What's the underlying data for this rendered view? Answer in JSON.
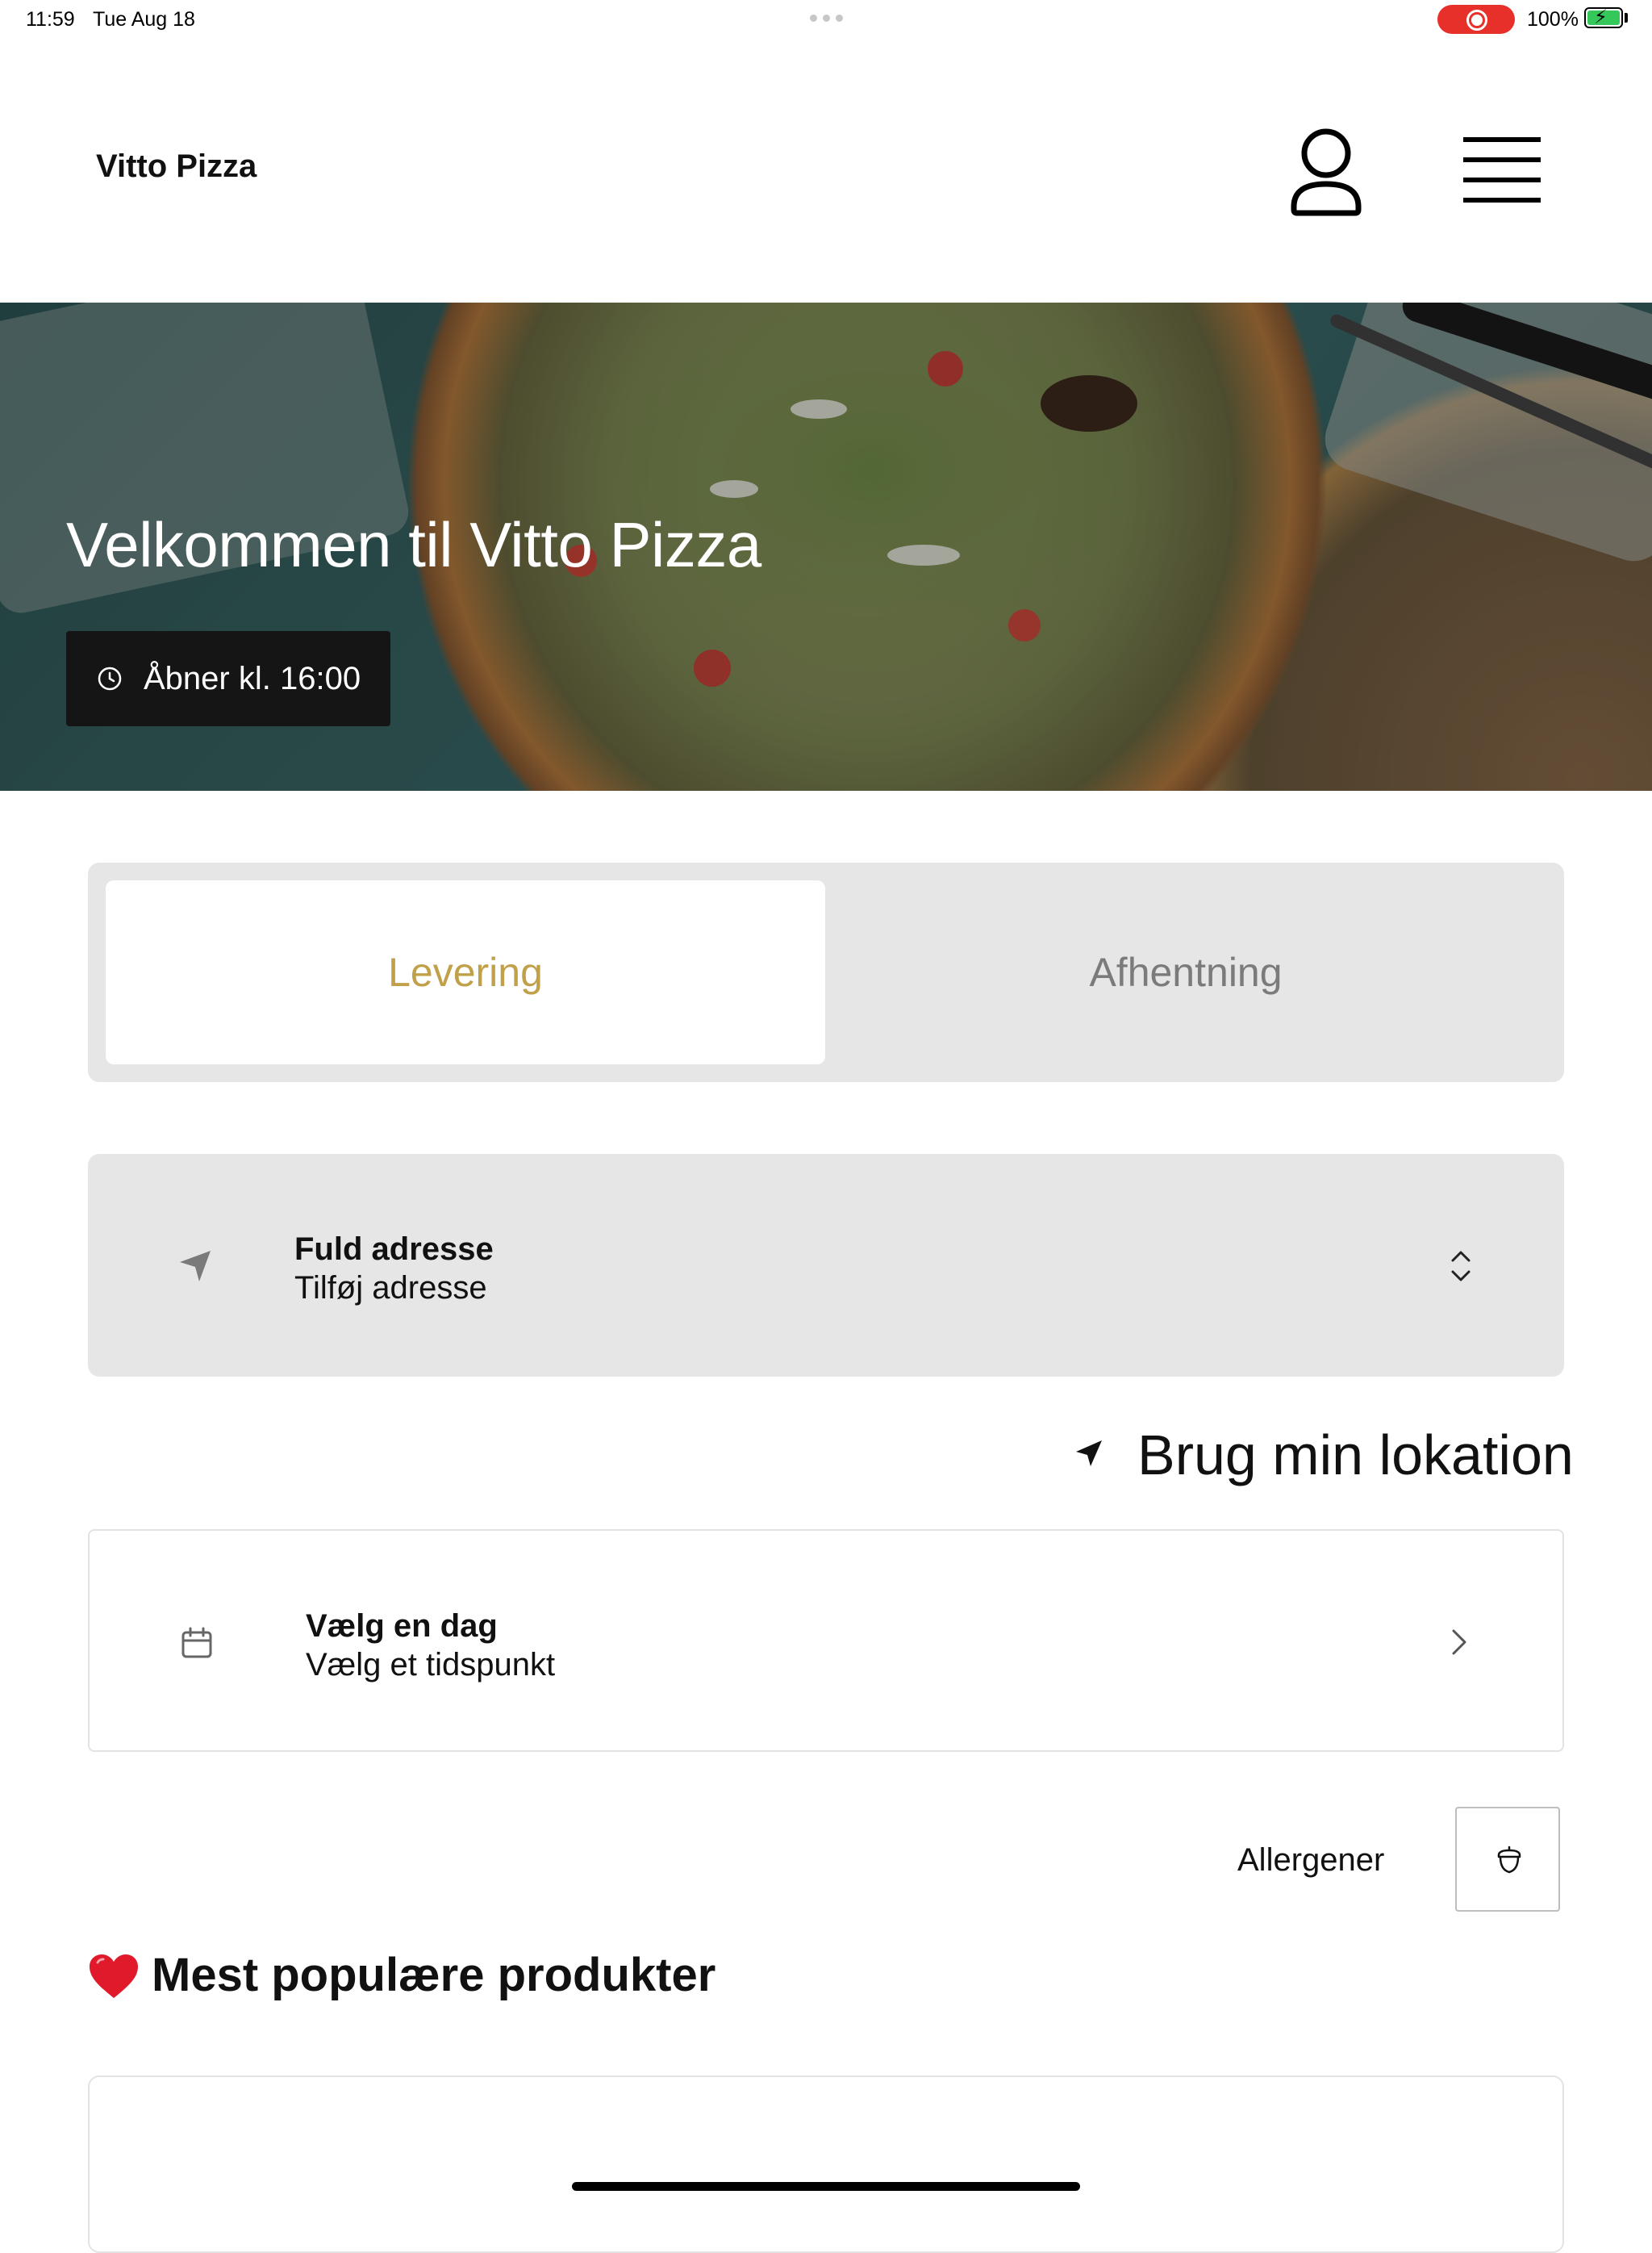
{
  "status_bar": {
    "time": "11:59",
    "date": "Tue Aug 18",
    "battery": "100%",
    "recording_color": "#e8302b"
  },
  "header": {
    "brand": "Vitto Pizza",
    "icons": [
      "user-icon",
      "menu-icon"
    ]
  },
  "hero": {
    "title": "Velkommen til Vitto Pizza",
    "opening": "Åbner kl. 16:00",
    "icon": "clock-icon"
  },
  "tabs": [
    {
      "label": "Levering",
      "selected": true
    },
    {
      "label": "Afhentning",
      "selected": false
    }
  ],
  "address": {
    "title": "Fuld adresse",
    "subtitle": "Tilføj adresse",
    "icons": [
      "navigation-arrow-icon",
      "chevron-up-down-icon"
    ]
  },
  "location": {
    "label": "Brug min lokation",
    "icon": "location-arrow-icon"
  },
  "schedule": {
    "title": "Vælg en dag",
    "subtitle": "Vælg et tidspunkt",
    "icons": [
      "calendar-icon",
      "chevron-right-icon"
    ]
  },
  "allergens": {
    "label": "Allergener",
    "icon": "acorn-icon"
  },
  "popular": {
    "title": "Mest populære produkter",
    "icon": "heart-icon"
  },
  "colors": {
    "accent": "#c1a04a",
    "tab_inactive_text": "#7b7b7b",
    "panel_bg": "#e6e6e6",
    "heart": "#e0192b"
  }
}
